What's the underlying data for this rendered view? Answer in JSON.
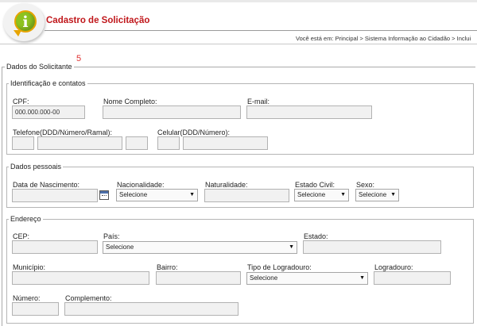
{
  "header": {
    "title": "Cadastro de Solicitação",
    "logo_letter": "i",
    "breadcrumb": "Você está em: Principal > Sistema Informação ao Cidadão > Inclui"
  },
  "form": {
    "section_title": "Dados do Solicitante",
    "counter": "5",
    "identificacao": {
      "legend": "Identificação e contatos",
      "cpf_label": "CPF:",
      "cpf_placeholder": "000.000.000-00",
      "nome_label": "Nome Completo:",
      "email_label": "E-mail:",
      "telefone_label": "Telefone(DDD/Número/Ramal):",
      "celular_label": "Celular(DDD/Número):"
    },
    "pessoais": {
      "legend": "Dados pessoais",
      "nascimento_label": "Data de Nascimento:",
      "nacionalidade_label": "Nacionalidade:",
      "nacionalidade_value": "Selecione",
      "naturalidade_label": "Naturalidade:",
      "estado_civil_label": "Estado Civil:",
      "estado_civil_value": "Selecione",
      "sexo_label": "Sexo:",
      "sexo_value": "Selecione"
    },
    "endereco": {
      "legend": "Endereço",
      "cep_label": "CEP:",
      "pais_label": "País:",
      "pais_value": "Selecione",
      "estado_label": "Estado:",
      "municipio_label": "Município:",
      "bairro_label": "Bairro:",
      "tipo_logradouro_label": "Tipo de Logradouro:",
      "tipo_logradouro_value": "Selecione",
      "logradouro_label": "Logradouro:",
      "numero_label": "Número:",
      "complemento_label": "Complemento:"
    }
  },
  "colors": {
    "title_red": "#c0171b",
    "logo_green": "#8dc21f",
    "logo_orange": "#e7a400"
  }
}
